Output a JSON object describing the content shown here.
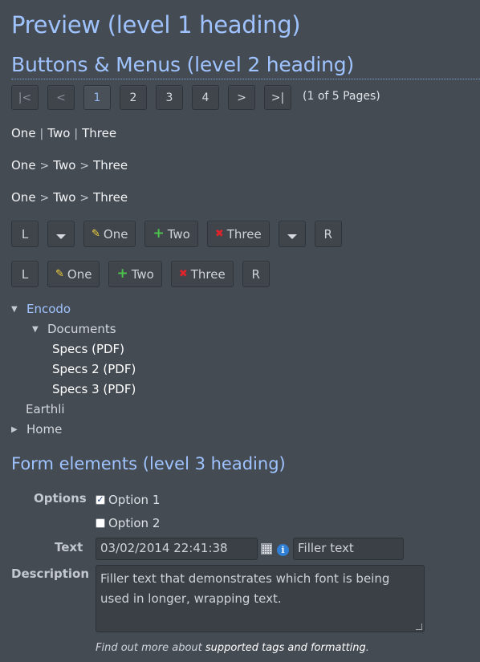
{
  "headings": {
    "h1": "Preview (level 1 heading)",
    "h2": "Buttons & Menus (level 2 heading)",
    "h3": "Form elements (level 3 heading)"
  },
  "pager": {
    "first": "|<",
    "prev": "<",
    "pages": [
      "1",
      "2",
      "3",
      "4"
    ],
    "current_page": "1",
    "next": ">",
    "last": ">|",
    "info": "(1 of 5 Pages)"
  },
  "breadcrumbs": [
    {
      "items": [
        "One",
        "Two",
        "Three"
      ],
      "separator": "|"
    },
    {
      "items": [
        "One",
        "Two",
        "Three"
      ],
      "separator": ">"
    },
    {
      "items": [
        "One",
        "Two",
        "Three"
      ],
      "separator": ">"
    }
  ],
  "button_row_1": {
    "left": "L",
    "one": "One",
    "two": "Two",
    "three": "Three",
    "right": "R"
  },
  "button_row_2": {
    "left": "L",
    "one": "One",
    "two": "Two",
    "three": "Three",
    "right": "R"
  },
  "icons": {
    "one": "pencil-icon",
    "two": "plus-icon",
    "three": "delete-x-icon",
    "pencil_color": "#f4d23a",
    "plus_color": "#4cc34c",
    "x_color": "#e0232a"
  },
  "tree": {
    "root": "Encodo",
    "documents": "Documents",
    "specs1": "Specs (PDF)",
    "specs2": "Specs 2 (PDF)",
    "specs3": "Specs 3 (PDF)",
    "earthli": "Earthli",
    "home": "Home"
  },
  "form": {
    "options_label": "Options",
    "option1": "Option 1",
    "option1_checked": true,
    "option2": "Option 2",
    "option2_checked": false,
    "text_label": "Text",
    "date_value": "03/02/2014 22:41:38",
    "filler_input": "Filler text",
    "description_label": "Description",
    "description_value": "Filler text that demonstrates which font is being used in longer, wrapping text.",
    "note_prefix": "Find out more about ",
    "note_link": "supported tags and formatting",
    "note_suffix": "."
  },
  "colors": {
    "background": "#454b53",
    "heading": "#9fc3ff",
    "link": "#9fc3ff"
  }
}
